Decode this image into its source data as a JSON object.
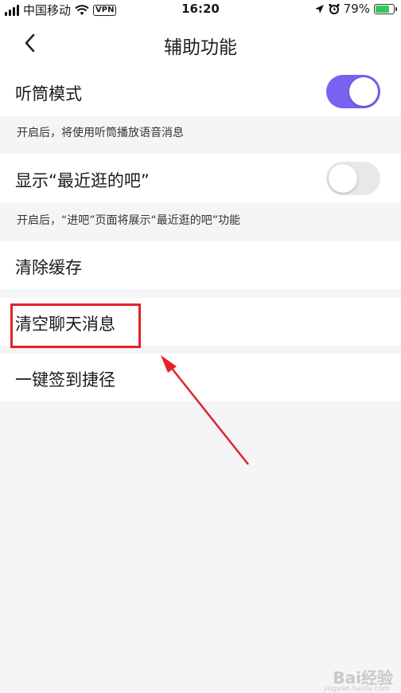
{
  "status_bar": {
    "carrier": "中国移动",
    "vpn": "VPN",
    "time": "16:20",
    "battery": "79%",
    "battery_level": 0.79
  },
  "nav": {
    "title": "辅助功能"
  },
  "settings": {
    "earpiece": {
      "label": "听筒模式",
      "enabled": true,
      "hint": "开启后，将使用听筒播放语音消息"
    },
    "recent_bars": {
      "label": "显示“最近逛的吧”",
      "enabled": false,
      "hint": "开启后，“进吧”页面将展示“最近逛的吧”功能"
    },
    "clear_cache": {
      "label": "清除缓存"
    },
    "clear_chat": {
      "label": "清空聊天消息"
    },
    "sign_in_shortcut": {
      "label": "一键签到捷径"
    }
  },
  "colors": {
    "toggle_on": "#7b61f2",
    "annotation": "#e0242a"
  },
  "watermark": {
    "text": "Bai经验",
    "sub": "jingyan.baidu.com"
  }
}
